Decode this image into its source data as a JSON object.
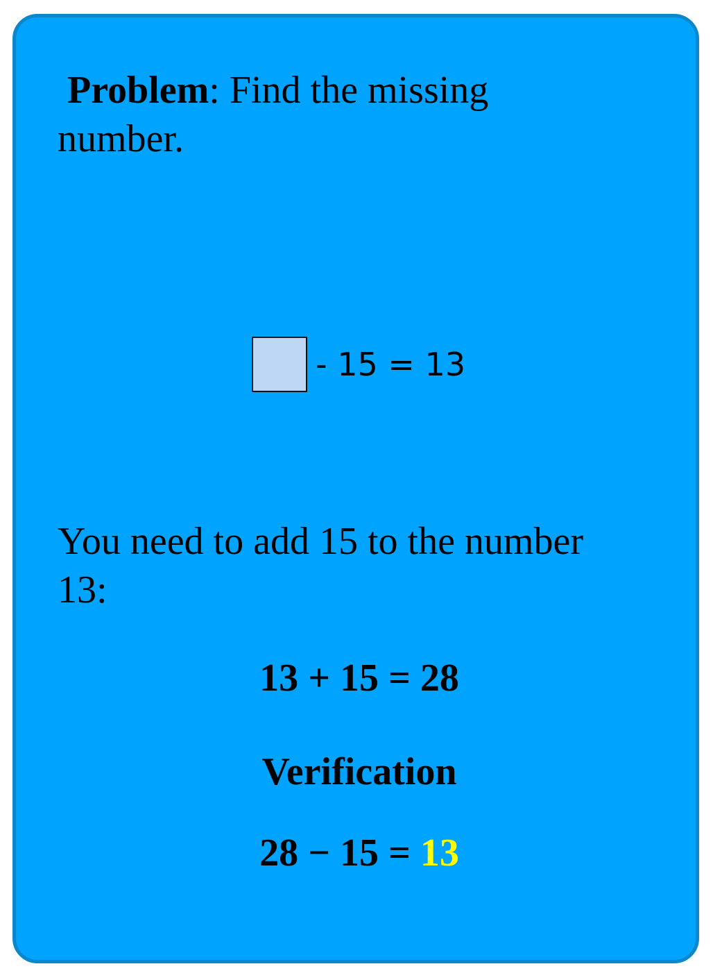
{
  "problem": {
    "label": "Problem",
    "text": ": Find the missing number."
  },
  "equation": {
    "text": "- 15 = 13",
    "box_color": "#bdd7f4"
  },
  "hint": "You need to add 15 to the number 13:",
  "solution": "13 + 15 = 28",
  "verification": {
    "title": "Verification",
    "lhs": "28 − 15 = ",
    "answer": "13",
    "answer_color": "#ffff00"
  },
  "colors": {
    "card": "#00a3fe",
    "border": "#0b87cc"
  }
}
